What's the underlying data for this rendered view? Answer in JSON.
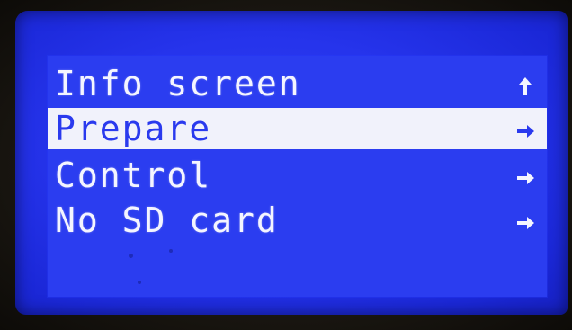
{
  "menu": {
    "items": [
      {
        "label": "Info screen",
        "arrow": "up-arrow-icon",
        "selected": false
      },
      {
        "label": "Prepare",
        "arrow": "right-arrow-icon",
        "selected": true
      },
      {
        "label": "Control",
        "arrow": "right-arrow-icon",
        "selected": false
      },
      {
        "label": "No SD card",
        "arrow": "right-arrow-icon",
        "selected": false
      }
    ]
  },
  "colors": {
    "screen_background": "#2634ec",
    "text": "#f4f5ff",
    "highlight": "#f1f2fb",
    "highlight_text": "#2a3aee",
    "bezel": "#1a1712"
  }
}
